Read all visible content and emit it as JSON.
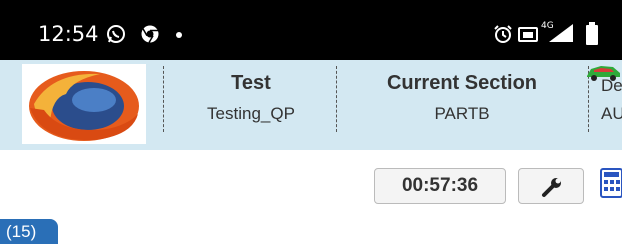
{
  "status_bar": {
    "time": "12:54",
    "icons": [
      "whatsapp-icon",
      "chrome-icon",
      "alarm-icon",
      "cast-icon",
      "signal-icon",
      "battery-icon"
    ],
    "network_label": "4G"
  },
  "header": {
    "test_title": "Test",
    "test_value": "Testing_QP",
    "section_title": "Current Section",
    "section_value": "PARTB",
    "third_title": "De",
    "third_value": "AU"
  },
  "toolbar": {
    "timer": "00:57:36",
    "icons": [
      "wrench-icon",
      "calculator-icon"
    ]
  },
  "badge": {
    "count_label": "(15)"
  },
  "colors": {
    "header_bg": "#d3e8f2",
    "badge_bg": "#2a6fb7",
    "status_bg": "#000000"
  }
}
